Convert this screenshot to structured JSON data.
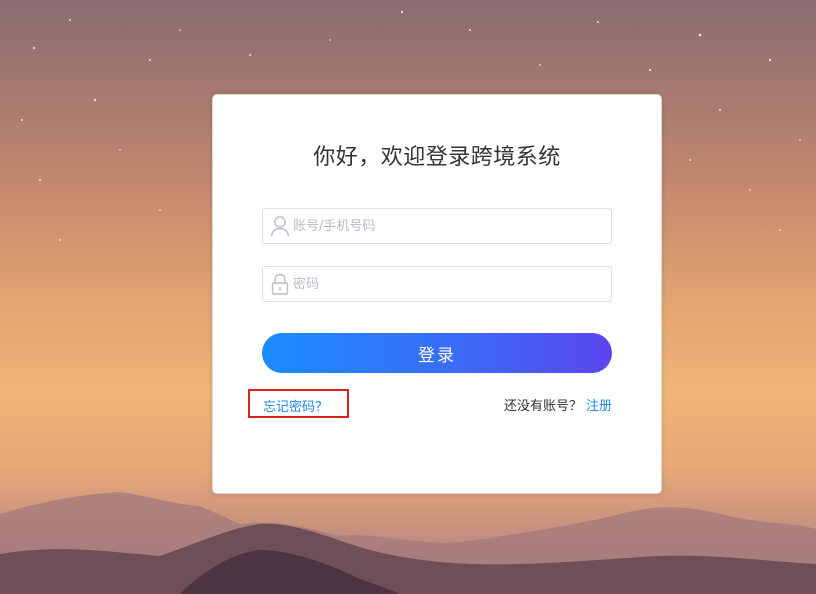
{
  "login": {
    "title": "你好，欢迎登录跨境系统",
    "account_placeholder": "账号/手机号码",
    "password_placeholder": "密码",
    "login_button": "登录",
    "forgot_password": "忘记密码？",
    "no_account": "还没有账号？",
    "register": "注册"
  },
  "icons": {
    "account": "user-icon",
    "password": "lock-icon"
  },
  "colors": {
    "link": "#2486e8",
    "button_gradient_start": "#1a8cff",
    "button_gradient_end": "#5b45f0",
    "highlight_box": "#e0201c"
  }
}
